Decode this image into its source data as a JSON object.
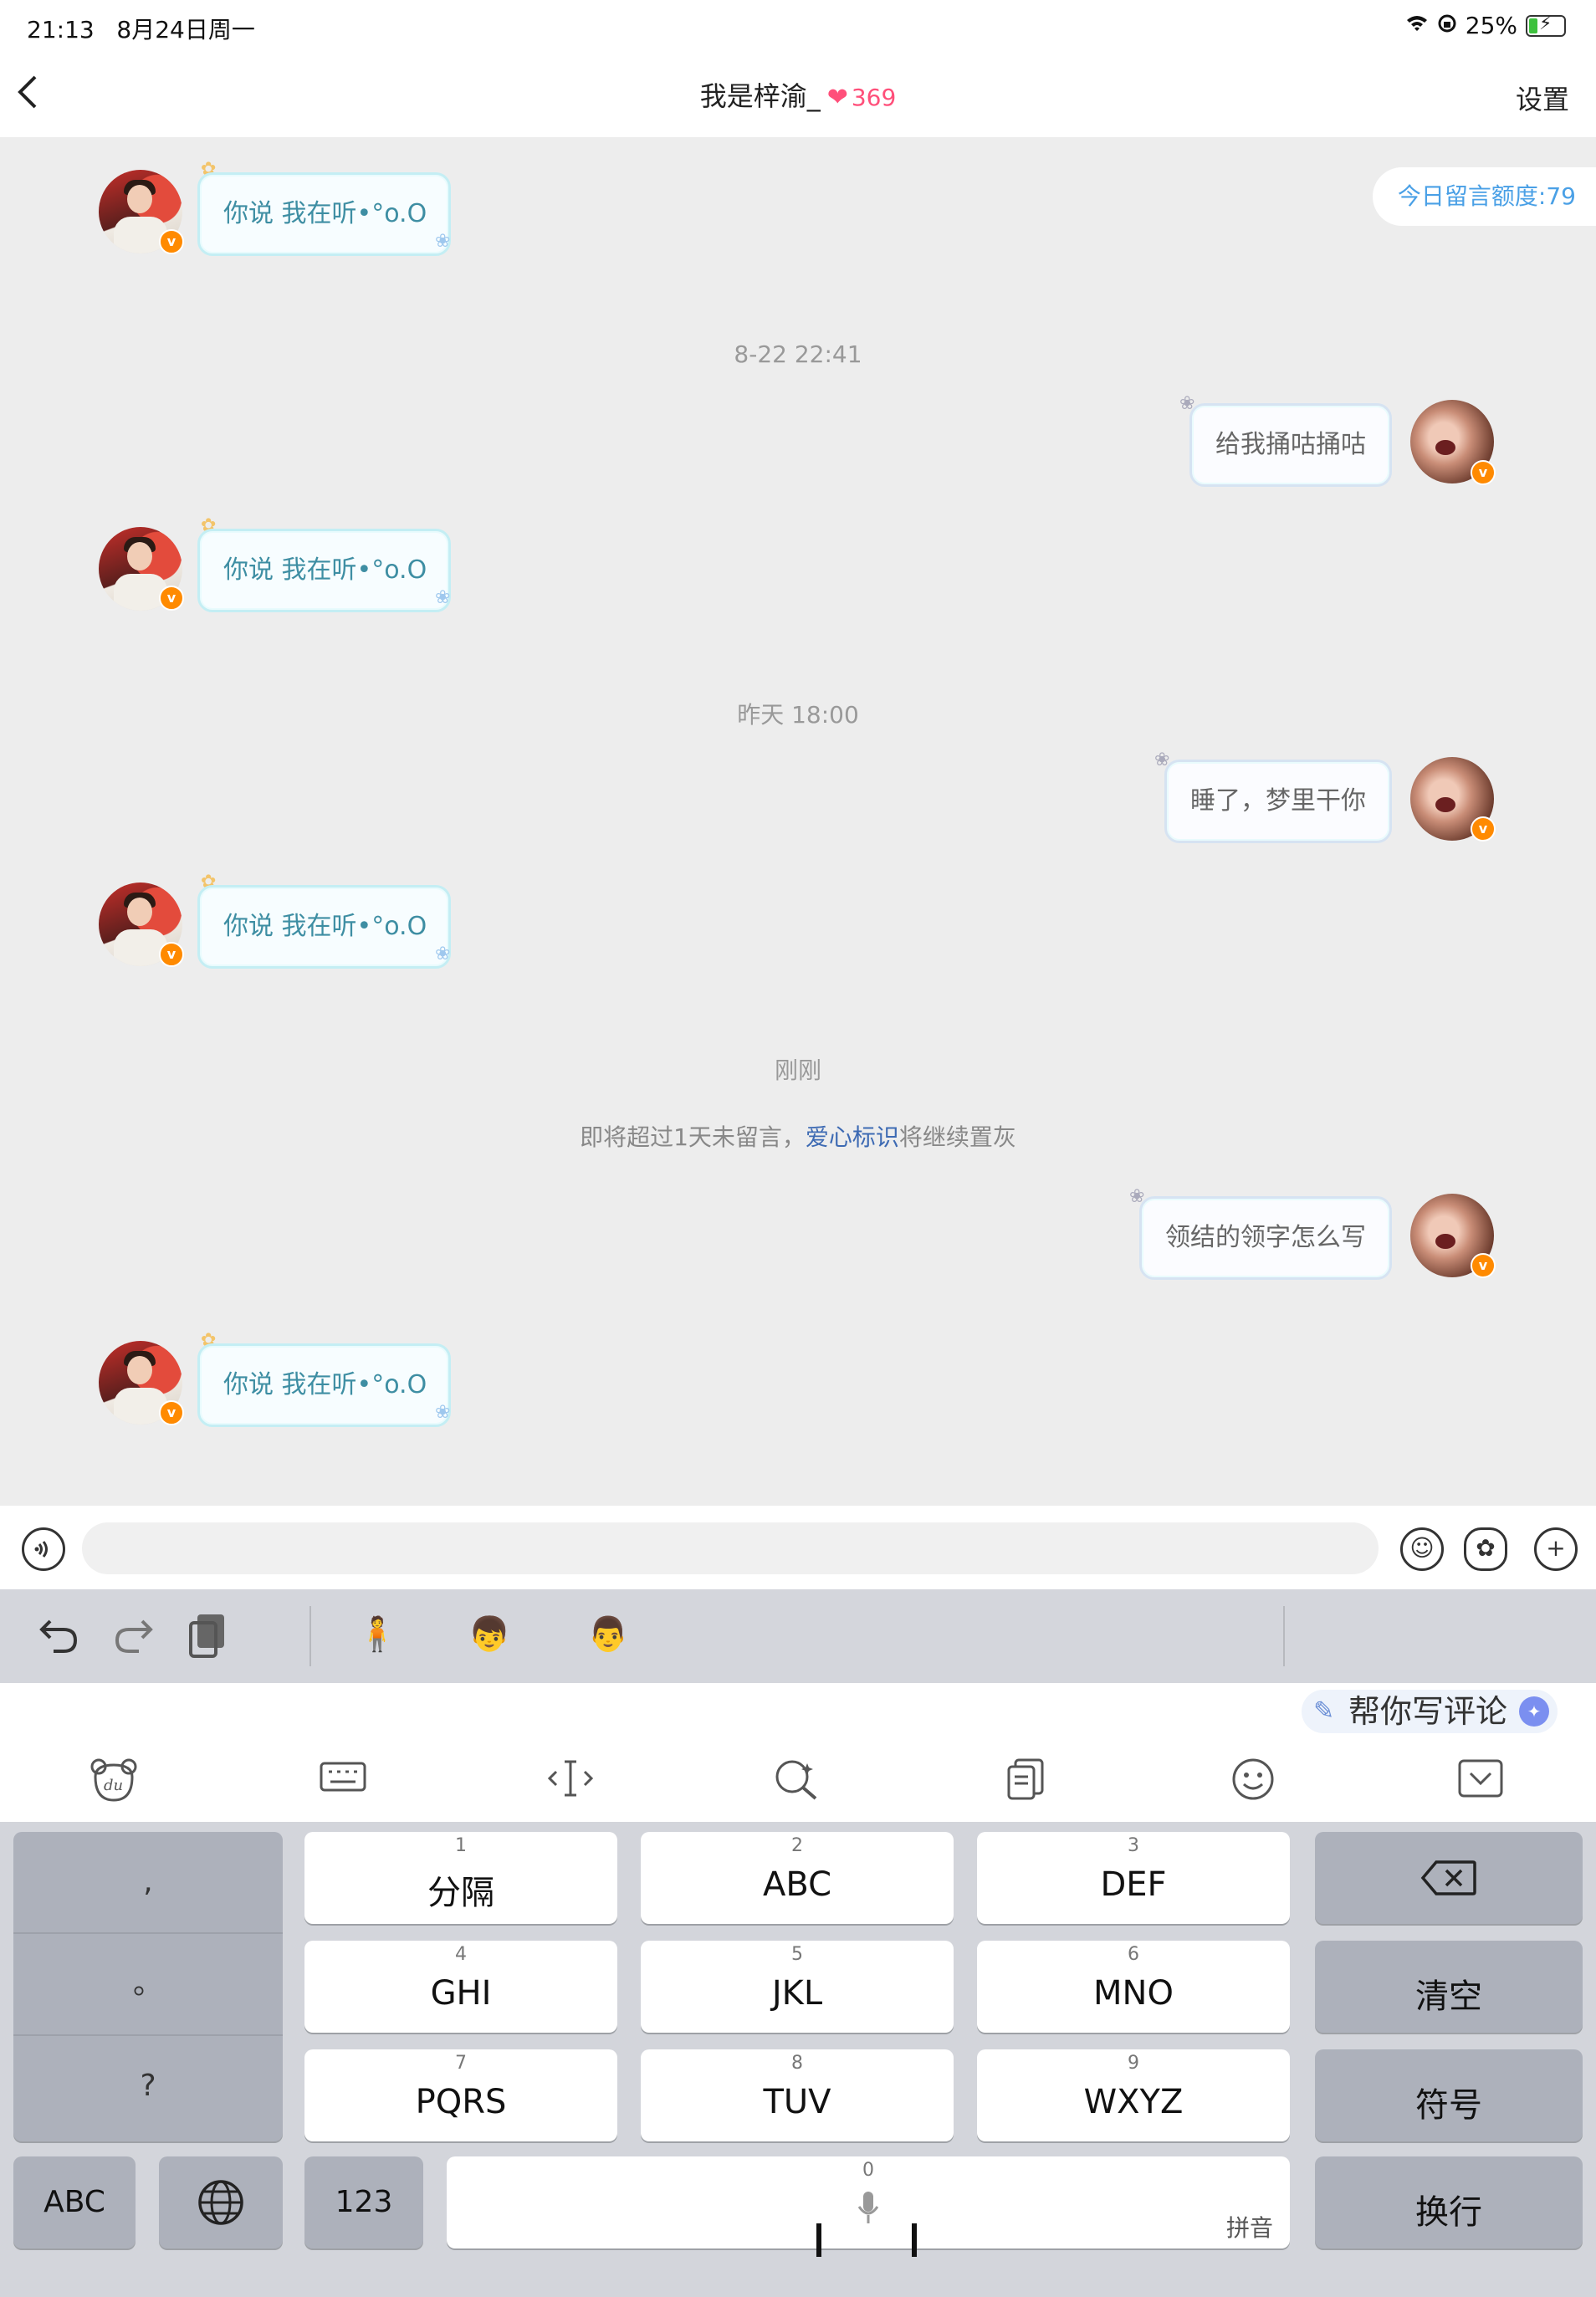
{
  "status_bar": {
    "time": "21:13",
    "date": "8月24日周一",
    "battery": "25%"
  },
  "header": {
    "title": "我是梓渝_",
    "heart": "❤",
    "count": "369",
    "settings_label": "设置",
    "back_label": "‹"
  },
  "quota": {
    "label": "今日留言额度:79"
  },
  "messages": {
    "left_1": "你说 我在听•°o.O",
    "ts_1": "8-22 22:41",
    "right_1": "给我捅咕捅咕",
    "left_2": "你说 我在听•°o.O",
    "ts_2": "昨天 18:00",
    "right_2": "睡了，梦里干你",
    "left_3": "你说 我在听•°o.O",
    "ts_3": "刚刚",
    "notice_pre": "即将超过1天未留言，",
    "notice_link": "爱心标识",
    "notice_post": "将继续置灰",
    "right_3": "领结的领字怎么写",
    "left_4": "你说 我在听•°o.O",
    "badge": "v"
  },
  "input": {
    "placeholder": ""
  },
  "keyboard": {
    "ai_label": "帮你写评论",
    "keys": [
      {
        "num": "1",
        "label": "分隔"
      },
      {
        "num": "2",
        "label": "ABC"
      },
      {
        "num": "3",
        "label": "DEF"
      },
      {
        "num": "4",
        "label": "GHI"
      },
      {
        "num": "5",
        "label": "JKL"
      },
      {
        "num": "6",
        "label": "MNO"
      },
      {
        "num": "7",
        "label": "PQRS"
      },
      {
        "num": "8",
        "label": "TUV"
      },
      {
        "num": "9",
        "label": "WXYZ"
      }
    ],
    "punct": [
      ",",
      "。",
      "?"
    ],
    "clear_label": "清空",
    "symbol_label": "符号",
    "abc_label": "ABC",
    "num_label": "123",
    "space_num": "0",
    "space_hint": "拼音",
    "enter_label": "换行"
  },
  "colors": {
    "accent": "#4aa0e6",
    "heart": "#ff4f7a",
    "link": "#3d6ab3"
  }
}
